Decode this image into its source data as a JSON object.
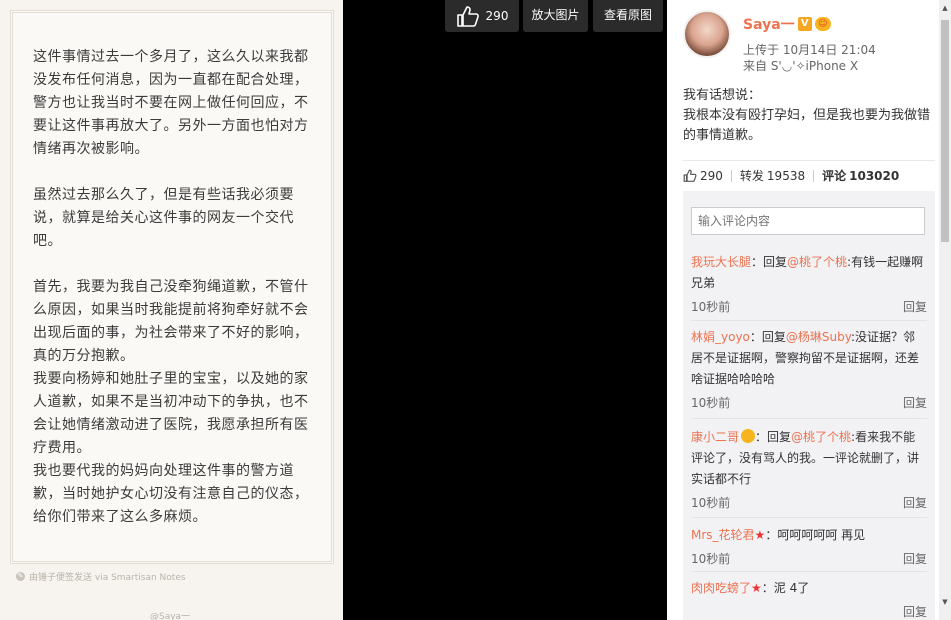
{
  "note": {
    "body": "这件事情过去一个多月了，这么久以来我都没发布任何消息，因为一直都在配合处理，警方也让我当时不要在网上做任何回应，不要让这件事再放大了。另外一方面也怕对方情绪再次被影响。\n\n虽然过去那么久了，但是有些话我必须要说，就算是给关心这件事的网友一个交代吧。\n\n首先，我要为我自己没牵狗绳道歉，不管什么原因，如果当时我能提前将狗牵好就不会出现后面的事，为社会带来了不好的影响，真的万分抱歉。\n我要向杨婷和她肚子里的宝宝，以及她的家人道歉，如果不是当初冲动下的争执，也不会让她情绪激动进了医院，我愿承担所有医疗费用。\n我也要代我的妈妈向处理这件事的警方道歉，当时她护女心切没有注意自己的仪态，给你们带来了这么多麻烦。",
    "footer": "由锤子便签发送  via Smartisan Notes",
    "watermark": "@Saya一"
  },
  "toolbar": {
    "like_count": "290",
    "zoom_label": "放大图片",
    "original_label": "查看原图"
  },
  "post": {
    "username": "Saya一",
    "v_badge": "V",
    "upload_time": "上传于 10月14日 21:04",
    "source": "来自 S'◡'✧iPhone X",
    "text_line1": "我有话想说：",
    "text_line2": "我根本没有殴打孕妇，但是我也要为我做错的事情道歉。"
  },
  "actions": {
    "likes": "290",
    "reposts_label": "转发",
    "reposts": "19538",
    "comments_label": "评论",
    "comments": "103020"
  },
  "comment_input": {
    "placeholder": "输入评论内容"
  },
  "comments": [
    {
      "user": "我玩大长腿",
      "reply_prefix": "：回复",
      "mention": "@桃了个桃",
      "text": ":有钱一起赚啊兄弟",
      "time": "10秒前",
      "reply": "回复"
    },
    {
      "user": "林娟_yoyo",
      "reply_prefix": "：回复",
      "mention": "@杨琳Suby",
      "text": ":没证据？邻居不是证据啊，警察拘留不是证据啊，还差啥证据哈哈哈哈",
      "time": "10秒前",
      "reply": "回复"
    },
    {
      "user": "康小二哥",
      "reply_prefix": "：回复",
      "mention": "@桃了个桃",
      "text": ":看来我不能评论了，没有骂人的我。一评论就删了，讲实话都不行",
      "time": "10秒前",
      "reply": "回复"
    },
    {
      "user": "Mrs_花轮君",
      "reply_prefix": "：",
      "mention": "",
      "text": "呵呵呵呵呵 再见",
      "time": "10秒前",
      "reply": "回复"
    },
    {
      "user": "肉肉吃螃了",
      "reply_prefix": "：",
      "mention": "",
      "text": "泥 4了",
      "time": "",
      "reply": "回复"
    }
  ]
}
